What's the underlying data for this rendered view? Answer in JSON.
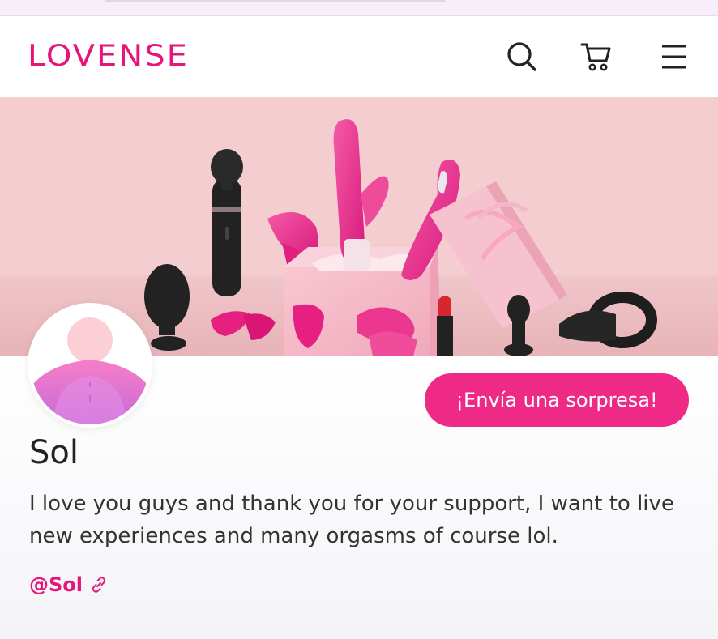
{
  "header": {
    "logo": "LOVENSE",
    "icons": [
      "search-icon",
      "cart-icon",
      "menu-icon"
    ]
  },
  "banner": {
    "description_icon": "gift-box-toys-illustration"
  },
  "profile": {
    "name": "Sol",
    "bio": "I love you guys and thank you for your support, I want to live new experiences and many orgasms of course lol.",
    "handle": "@Sol",
    "cta_label": "¡Envía una sorpresa!"
  },
  "colors": {
    "brand": "#e5157a",
    "cta": "#ee2a86",
    "banner_bg": "#f3cfd2"
  }
}
